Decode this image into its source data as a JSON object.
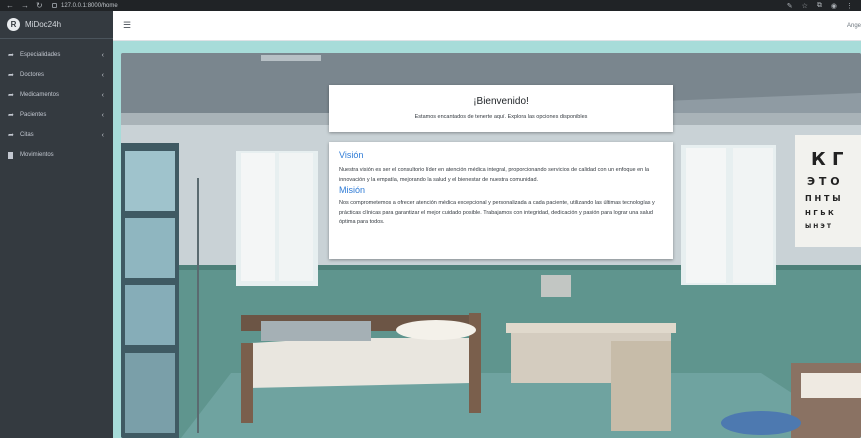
{
  "browser": {
    "url": "127.0.0.1:8000/home"
  },
  "sidebar": {
    "brand": "MiDoc24h",
    "brand_initial": "R",
    "items": [
      {
        "label": "Especialidades",
        "has_children": true
      },
      {
        "label": "Doctores",
        "has_children": true
      },
      {
        "label": "Medicamentos",
        "has_children": true
      },
      {
        "label": "Pacientes",
        "has_children": true
      },
      {
        "label": "Citas",
        "has_children": true
      },
      {
        "label": "Movimientos",
        "has_children": false
      }
    ]
  },
  "topbar": {
    "user": "Ange"
  },
  "welcome": {
    "title": "¡Bienvenido!",
    "subtitle": "Estamos encantados de tenerte aquí. Explora las opciones disponibles"
  },
  "vision": {
    "title": "Visión",
    "text": "Nuestra visión es ser el consultorio líder en atención médica integral, proporcionando servicios de calidad con un enfoque en la innovación y la empatía, mejorando la salud y el bienestar de nuestra comunidad."
  },
  "mision": {
    "title": "Misión",
    "text": "Nos comprometemos a ofrecer atención médica excepcional y personalizada a cada paciente, utilizando las últimas tecnologías y prácticas clínicas para garantizar el mejor cuidado posible. Trabajamos con integridad, dedicación y pasión para lograr una salud óptima para todos."
  },
  "eye_chart": {
    "rows": [
      "К Г",
      "Э Т О",
      "П Н Т Ы",
      "Н Г Ь К",
      "Ы Н Э Т"
    ]
  },
  "colors": {
    "sidebar_bg": "#343a40",
    "accent_blue": "#2e7bd6",
    "content_bg": "#a7dcd9"
  }
}
